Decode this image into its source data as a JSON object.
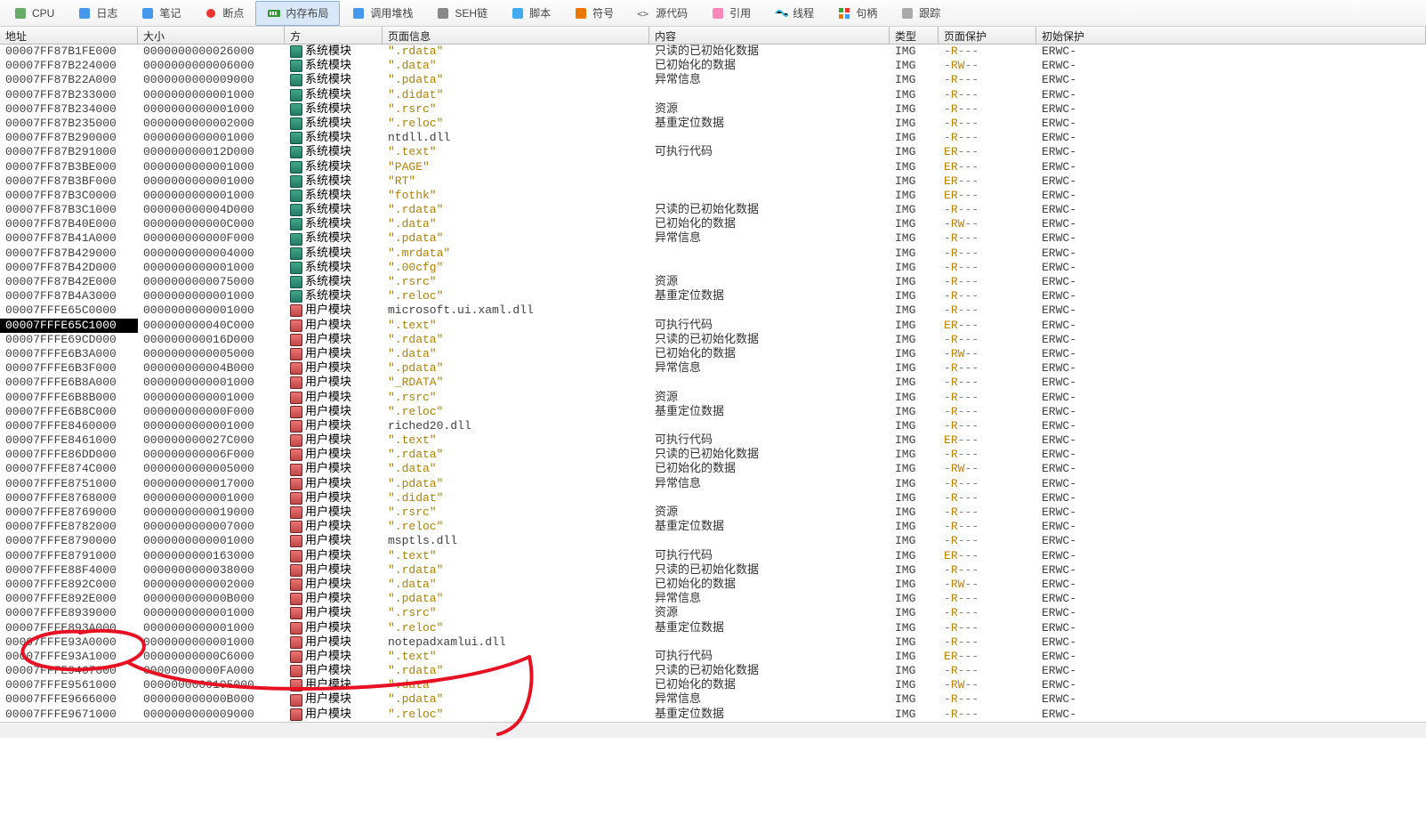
{
  "toolbar": [
    {
      "name": "tab-cpu",
      "icon": "cpu",
      "label": "CPU"
    },
    {
      "name": "tab-log",
      "icon": "log",
      "label": "日志"
    },
    {
      "name": "tab-notes",
      "icon": "notes",
      "label": "笔记"
    },
    {
      "name": "tab-breakpoints",
      "icon": "bp",
      "label": "断点"
    },
    {
      "name": "tab-memmap",
      "icon": "mem",
      "label": "内存布局",
      "sel": true
    },
    {
      "name": "tab-callstack",
      "icon": "stack",
      "label": "调用堆栈"
    },
    {
      "name": "tab-seh",
      "icon": "seh",
      "label": "SEH链"
    },
    {
      "name": "tab-script",
      "icon": "script",
      "label": "脚本"
    },
    {
      "name": "tab-symbols",
      "icon": "sym",
      "label": "符号"
    },
    {
      "name": "tab-source",
      "icon": "src",
      "label": "源代码"
    },
    {
      "name": "tab-refs",
      "icon": "refs",
      "label": "引用"
    },
    {
      "name": "tab-threads",
      "icon": "thr",
      "label": "线程"
    },
    {
      "name": "tab-handles",
      "icon": "hnd",
      "label": "句柄"
    },
    {
      "name": "tab-trace",
      "icon": "trc",
      "label": "跟踪"
    }
  ],
  "headers": {
    "addr": "地址",
    "size": "大小",
    "side": "方",
    "info": "页面信息",
    "content": "内容",
    "type": "类型",
    "prot": "页面保护",
    "init": "初始保护"
  },
  "side_labels": {
    "sys": "系统模块",
    "usr": "用户模块"
  },
  "rows": [
    {
      "a": "00007FF87B1FE000",
      "s": "0000000000026000",
      "m": "sys",
      "i": "\".rdata\"",
      "c": "只读的已初始化数据",
      "t": "IMG",
      "p": "-R---",
      "q": "ERWC-"
    },
    {
      "a": "00007FF87B224000",
      "s": "0000000000006000",
      "m": "sys",
      "i": "\".data\"",
      "c": "已初始化的数据",
      "t": "IMG",
      "p": "-RW--",
      "q": "ERWC-"
    },
    {
      "a": "00007FF87B22A000",
      "s": "0000000000009000",
      "m": "sys",
      "i": "\".pdata\"",
      "c": "异常信息",
      "t": "IMG",
      "p": "-R---",
      "q": "ERWC-"
    },
    {
      "a": "00007FF87B233000",
      "s": "0000000000001000",
      "m": "sys",
      "i": "\".didat\"",
      "c": "",
      "t": "IMG",
      "p": "-R---",
      "q": "ERWC-"
    },
    {
      "a": "00007FF87B234000",
      "s": "0000000000001000",
      "m": "sys",
      "i": "\".rsrc\"",
      "c": "资源",
      "t": "IMG",
      "p": "-R---",
      "q": "ERWC-"
    },
    {
      "a": "00007FF87B235000",
      "s": "0000000000002000",
      "m": "sys",
      "i": "\".reloc\"",
      "c": "基重定位数据",
      "t": "IMG",
      "p": "-R---",
      "q": "ERWC-"
    },
    {
      "a": "00007FF87B290000",
      "s": "0000000000001000",
      "m": "sys",
      "i": "ntdll.dll",
      "c": "",
      "t": "IMG",
      "p": "-R---",
      "q": "ERWC-",
      "plain": true
    },
    {
      "a": "00007FF87B291000",
      "s": "000000000012D000",
      "m": "sys",
      "i": "\".text\"",
      "c": "可执行代码",
      "t": "IMG",
      "p": "ER---",
      "q": "ERWC-"
    },
    {
      "a": "00007FF87B3BE000",
      "s": "0000000000001000",
      "m": "sys",
      "i": "\"PAGE\"",
      "c": "",
      "t": "IMG",
      "p": "ER---",
      "q": "ERWC-"
    },
    {
      "a": "00007FF87B3BF000",
      "s": "0000000000001000",
      "m": "sys",
      "i": "\"RT\"",
      "c": "",
      "t": "IMG",
      "p": "ER---",
      "q": "ERWC-"
    },
    {
      "a": "00007FF87B3C0000",
      "s": "0000000000001000",
      "m": "sys",
      "i": "\"fothk\"",
      "c": "",
      "t": "IMG",
      "p": "ER---",
      "q": "ERWC-"
    },
    {
      "a": "00007FF87B3C1000",
      "s": "000000000004D000",
      "m": "sys",
      "i": "\".rdata\"",
      "c": "只读的已初始化数据",
      "t": "IMG",
      "p": "-R---",
      "q": "ERWC-"
    },
    {
      "a": "00007FF87B40E000",
      "s": "000000000000C000",
      "m": "sys",
      "i": "\".data\"",
      "c": "已初始化的数据",
      "t": "IMG",
      "p": "-RW--",
      "q": "ERWC-"
    },
    {
      "a": "00007FF87B41A000",
      "s": "000000000000F000",
      "m": "sys",
      "i": "\".pdata\"",
      "c": "异常信息",
      "t": "IMG",
      "p": "-R---",
      "q": "ERWC-"
    },
    {
      "a": "00007FF87B429000",
      "s": "0000000000004000",
      "m": "sys",
      "i": "\".mrdata\"",
      "c": "",
      "t": "IMG",
      "p": "-R---",
      "q": "ERWC-"
    },
    {
      "a": "00007FF87B42D000",
      "s": "0000000000001000",
      "m": "sys",
      "i": "\".00cfg\"",
      "c": "",
      "t": "IMG",
      "p": "-R---",
      "q": "ERWC-"
    },
    {
      "a": "00007FF87B42E000",
      "s": "0000000000075000",
      "m": "sys",
      "i": "\".rsrc\"",
      "c": "资源",
      "t": "IMG",
      "p": "-R---",
      "q": "ERWC-"
    },
    {
      "a": "00007FF87B4A3000",
      "s": "0000000000001000",
      "m": "sys",
      "i": "\".reloc\"",
      "c": "基重定位数据",
      "t": "IMG",
      "p": "-R---",
      "q": "ERWC-"
    },
    {
      "a": "00007FFFE65C0000",
      "s": "0000000000001000",
      "m": "usr",
      "i": "microsoft.ui.xaml.dll",
      "c": "",
      "t": "IMG",
      "p": "-R---",
      "q": "ERWC-",
      "plain": true
    },
    {
      "a": "00007FFFE65C1000",
      "s": "000000000040C000",
      "m": "usr",
      "i": "\".text\"",
      "c": "可执行代码",
      "t": "IMG",
      "p": "ER---",
      "q": "ERWC-",
      "sel": true
    },
    {
      "a": "00007FFFE69CD000",
      "s": "000000000016D000",
      "m": "usr",
      "i": "\".rdata\"",
      "c": "只读的已初始化数据",
      "t": "IMG",
      "p": "-R---",
      "q": "ERWC-"
    },
    {
      "a": "00007FFFE6B3A000",
      "s": "0000000000005000",
      "m": "usr",
      "i": "\".data\"",
      "c": "已初始化的数据",
      "t": "IMG",
      "p": "-RW--",
      "q": "ERWC-"
    },
    {
      "a": "00007FFFE6B3F000",
      "s": "000000000004B000",
      "m": "usr",
      "i": "\".pdata\"",
      "c": "异常信息",
      "t": "IMG",
      "p": "-R---",
      "q": "ERWC-"
    },
    {
      "a": "00007FFFE6B8A000",
      "s": "0000000000001000",
      "m": "usr",
      "i": "\"_RDATA\"",
      "c": "",
      "t": "IMG",
      "p": "-R---",
      "q": "ERWC-"
    },
    {
      "a": "00007FFFE6B8B000",
      "s": "0000000000001000",
      "m": "usr",
      "i": "\".rsrc\"",
      "c": "资源",
      "t": "IMG",
      "p": "-R---",
      "q": "ERWC-"
    },
    {
      "a": "00007FFFE6B8C000",
      "s": "000000000000F000",
      "m": "usr",
      "i": "\".reloc\"",
      "c": "基重定位数据",
      "t": "IMG",
      "p": "-R---",
      "q": "ERWC-"
    },
    {
      "a": "00007FFFE8460000",
      "s": "0000000000001000",
      "m": "usr",
      "i": "riched20.dll",
      "c": "",
      "t": "IMG",
      "p": "-R---",
      "q": "ERWC-",
      "plain": true
    },
    {
      "a": "00007FFFE8461000",
      "s": "000000000027C000",
      "m": "usr",
      "i": "\".text\"",
      "c": "可执行代码",
      "t": "IMG",
      "p": "ER---",
      "q": "ERWC-"
    },
    {
      "a": "00007FFFE86DD000",
      "s": "000000000006F000",
      "m": "usr",
      "i": "\".rdata\"",
      "c": "只读的已初始化数据",
      "t": "IMG",
      "p": "-R---",
      "q": "ERWC-"
    },
    {
      "a": "00007FFFE874C000",
      "s": "0000000000005000",
      "m": "usr",
      "i": "\".data\"",
      "c": "已初始化的数据",
      "t": "IMG",
      "p": "-RW--",
      "q": "ERWC-"
    },
    {
      "a": "00007FFFE8751000",
      "s": "0000000000017000",
      "m": "usr",
      "i": "\".pdata\"",
      "c": "异常信息",
      "t": "IMG",
      "p": "-R---",
      "q": "ERWC-"
    },
    {
      "a": "00007FFFE8768000",
      "s": "0000000000001000",
      "m": "usr",
      "i": "\".didat\"",
      "c": "",
      "t": "IMG",
      "p": "-R---",
      "q": "ERWC-"
    },
    {
      "a": "00007FFFE8769000",
      "s": "0000000000019000",
      "m": "usr",
      "i": "\".rsrc\"",
      "c": "资源",
      "t": "IMG",
      "p": "-R---",
      "q": "ERWC-"
    },
    {
      "a": "00007FFFE8782000",
      "s": "0000000000007000",
      "m": "usr",
      "i": "\".reloc\"",
      "c": "基重定位数据",
      "t": "IMG",
      "p": "-R---",
      "q": "ERWC-"
    },
    {
      "a": "00007FFFE8790000",
      "s": "0000000000001000",
      "m": "usr",
      "i": "msptls.dll",
      "c": "",
      "t": "IMG",
      "p": "-R---",
      "q": "ERWC-",
      "plain": true
    },
    {
      "a": "00007FFFE8791000",
      "s": "0000000000163000",
      "m": "usr",
      "i": "\".text\"",
      "c": "可执行代码",
      "t": "IMG",
      "p": "ER---",
      "q": "ERWC-"
    },
    {
      "a": "00007FFFE88F4000",
      "s": "0000000000038000",
      "m": "usr",
      "i": "\".rdata\"",
      "c": "只读的已初始化数据",
      "t": "IMG",
      "p": "-R---",
      "q": "ERWC-"
    },
    {
      "a": "00007FFFE892C000",
      "s": "0000000000002000",
      "m": "usr",
      "i": "\".data\"",
      "c": "已初始化的数据",
      "t": "IMG",
      "p": "-RW--",
      "q": "ERWC-"
    },
    {
      "a": "00007FFFE892E000",
      "s": "000000000000B000",
      "m": "usr",
      "i": "\".pdata\"",
      "c": "异常信息",
      "t": "IMG",
      "p": "-R---",
      "q": "ERWC-"
    },
    {
      "a": "00007FFFE8939000",
      "s": "0000000000001000",
      "m": "usr",
      "i": "\".rsrc\"",
      "c": "资源",
      "t": "IMG",
      "p": "-R---",
      "q": "ERWC-"
    },
    {
      "a": "00007FFFE893A000",
      "s": "0000000000001000",
      "m": "usr",
      "i": "\".reloc\"",
      "c": "基重定位数据",
      "t": "IMG",
      "p": "-R---",
      "q": "ERWC-"
    },
    {
      "a": "00007FFFE93A0000",
      "s": "0000000000001000",
      "m": "usr",
      "i": "notepadxamlui.dll",
      "c": "",
      "t": "IMG",
      "p": "-R---",
      "q": "ERWC-",
      "plain": true
    },
    {
      "a": "00007FFFE93A1000",
      "s": "00000000000C6000",
      "m": "usr",
      "i": "\".text\"",
      "c": "可执行代码",
      "t": "IMG",
      "p": "ER---",
      "q": "ERWC-"
    },
    {
      "a": "00007FFFE9467000",
      "s": "00000000000FA000",
      "m": "usr",
      "i": "\".rdata\"",
      "c": "只读的已初始化数据",
      "t": "IMG",
      "p": "-R---",
      "q": "ERWC-"
    },
    {
      "a": "00007FFFE9561000",
      "s": "0000000000105000",
      "m": "usr",
      "i": "\".data\"",
      "c": "已初始化的数据",
      "t": "IMG",
      "p": "-RW--",
      "q": "ERWC-"
    },
    {
      "a": "00007FFFE9666000",
      "s": "000000000000B000",
      "m": "usr",
      "i": "\".pdata\"",
      "c": "异常信息",
      "t": "IMG",
      "p": "-R---",
      "q": "ERWC-"
    },
    {
      "a": "00007FFFE9671000",
      "s": "0000000000009000",
      "m": "usr",
      "i": "\".reloc\"",
      "c": "基重定位数据",
      "t": "IMG",
      "p": "-R---",
      "q": "ERWC-"
    }
  ]
}
